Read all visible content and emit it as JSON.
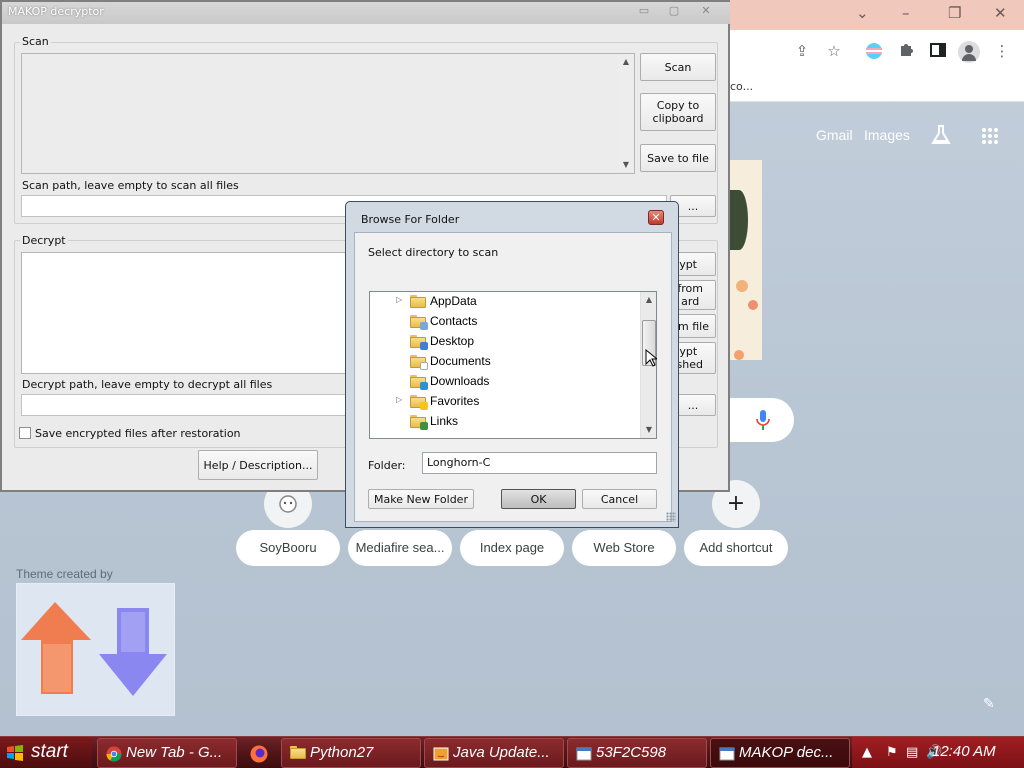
{
  "chrome": {
    "bookmark_fragment": "co...",
    "links": {
      "gmail": "Gmail",
      "images": "Images"
    },
    "shortcuts": [
      {
        "label": "SoyBooru"
      },
      {
        "label": "Mediafire sea..."
      },
      {
        "label": "Index page"
      },
      {
        "label": "Web Store"
      },
      {
        "label": "Add shortcut"
      }
    ],
    "add_icon": "+",
    "theme_created_by": "Theme created by"
  },
  "makop": {
    "title": "MAKOP decryptor",
    "scan": {
      "group_label": "Scan",
      "path_label": "Scan path, leave empty to scan all files",
      "path_value": "",
      "buttons": {
        "scan": "Scan",
        "copy": "Copy to clipboard",
        "save": "Save to file",
        "browse": "..."
      }
    },
    "decrypt": {
      "group_label": "Decrypt",
      "path_label": "Decrypt path, leave empty to decrypt all files",
      "path_value": "",
      "buttons": {
        "decrypt": "ypt",
        "from_clipboard": "from\nard",
        "from_file": "om file",
        "decrypt_finished": "ypt\nished",
        "browse": "..."
      }
    },
    "save_encrypted_label": "Save encrypted files after restoration",
    "save_encrypted_checked": false,
    "help_button": "Help / Description..."
  },
  "dialog": {
    "title": "Browse For Folder",
    "close": "✕",
    "prompt": "Select directory to scan",
    "tree_items": [
      {
        "label": "AppData",
        "expandable": true,
        "overlay": ""
      },
      {
        "label": "Contacts",
        "expandable": false,
        "overlay": "#7aa7d9"
      },
      {
        "label": "Desktop",
        "expandable": false,
        "overlay": "#3f7ed6"
      },
      {
        "label": "Documents",
        "expandable": false,
        "overlay": "#ffffff"
      },
      {
        "label": "Downloads",
        "expandable": false,
        "overlay": "#2f8fd8"
      },
      {
        "label": "Favorites",
        "expandable": true,
        "overlay": "#f5c518"
      },
      {
        "label": "Links",
        "expandable": false,
        "overlay": "#3f8f3f"
      }
    ],
    "folder_label": "Folder:",
    "folder_value": "Longhorn-C",
    "buttons": {
      "new_folder": "Make New Folder",
      "ok": "OK",
      "cancel": "Cancel"
    }
  },
  "taskbar": {
    "start": "start",
    "tasks": [
      {
        "label": "New Tab - G...",
        "icon": "chrome-icon"
      },
      {
        "label": "Python27",
        "icon": "folder-icon"
      },
      {
        "label": "Java Update...",
        "icon": "java-icon"
      },
      {
        "label": "53F2C598",
        "icon": "window-icon"
      },
      {
        "label": "MAKOP dec...",
        "icon": "window-icon"
      }
    ],
    "clock": "12:40 AM"
  }
}
